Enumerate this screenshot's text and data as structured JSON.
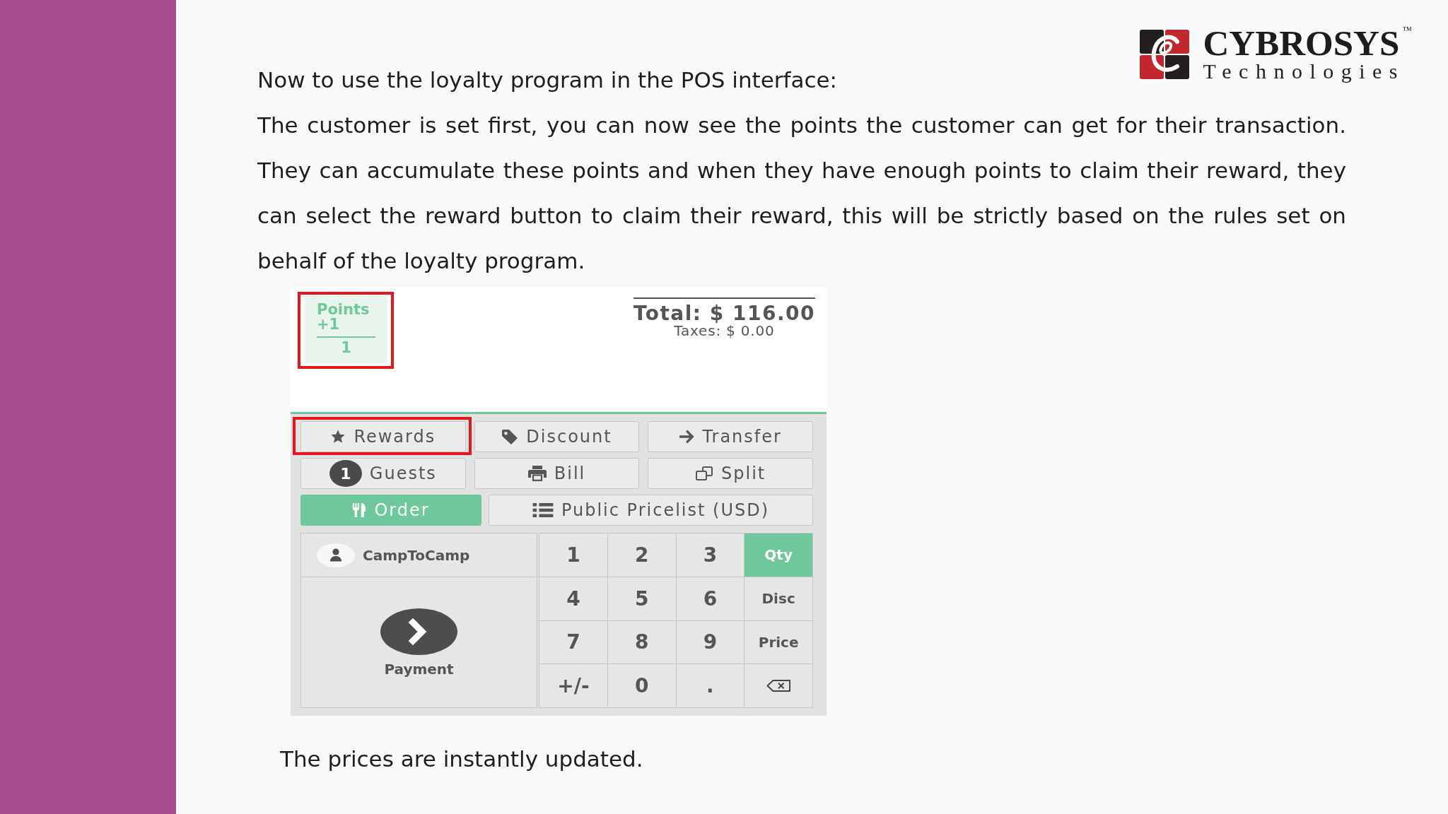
{
  "logo": {
    "name": "CYBROSYS",
    "trademark": "™",
    "tagline": "Technologies"
  },
  "heading": "Now to use the loyalty program in the POS interface:",
  "paragraph": "The customer is set first, you can now see the points the customer can get for their transaction. They can accumulate these points and when they have enough points to claim their reward, they can select the reward button to claim their reward, this will be strictly based on the rules set on behalf of the loyalty program.",
  "pos": {
    "loyalty": {
      "label": "Points",
      "change": "+1",
      "total": "1",
      "highlighted": true
    },
    "summary": {
      "total": "Total: $ 116.00",
      "taxes": "Taxes: $ 0.00"
    },
    "control_buttons": [
      {
        "kind": "reward",
        "label": "Rewards",
        "active": false,
        "highlighted": true
      },
      {
        "kind": "discount",
        "label": "Discount",
        "active": false,
        "highlighted": false
      },
      {
        "kind": "transfer",
        "label": "Transfer",
        "active": false,
        "highlighted": false
      },
      {
        "kind": "guests",
        "label": "Guests",
        "count": "1",
        "active": false,
        "highlighted": false
      },
      {
        "kind": "bill",
        "label": "Bill",
        "active": false,
        "highlighted": false
      },
      {
        "kind": "split",
        "label": "Split",
        "active": false,
        "highlighted": false
      },
      {
        "kind": "order",
        "label": "Order",
        "active": true,
        "highlighted": false
      },
      {
        "kind": "pricelist",
        "label": "Public Pricelist (USD)",
        "active": false,
        "highlighted": false
      }
    ],
    "customer": {
      "name": "CampToCamp"
    },
    "payment": {
      "label": "Payment"
    },
    "numpad": {
      "keys": [
        "1",
        "2",
        "3",
        "4",
        "5",
        "6",
        "7",
        "8",
        "9",
        "+/-",
        "0",
        "."
      ],
      "modes": [
        {
          "label": "Qty",
          "selected": true
        },
        {
          "label": "Disc",
          "selected": false
        },
        {
          "label": "Price",
          "selected": false
        }
      ]
    }
  },
  "caption": "The prices are instantly updated."
}
